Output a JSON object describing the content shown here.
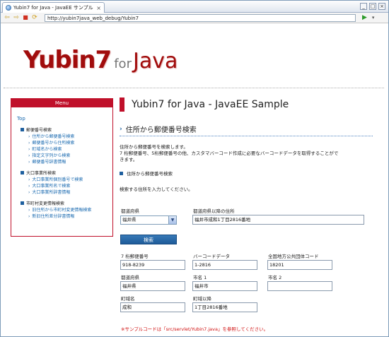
{
  "browser": {
    "tab_title": "Yubin7 for Java - JavaEE サンプル",
    "tab_close": "×",
    "url": "http://yubin7java_web_debug/Yubin7",
    "min": "_",
    "max": "□",
    "close": "×",
    "back": "⇦",
    "forward": "⇨",
    "stop": "■",
    "refresh": "⟳",
    "go": "▶",
    "menu": "▾"
  },
  "logo": {
    "main": "Yubin7",
    "for": "for",
    "java": "Java"
  },
  "sidebar": {
    "title": "Menu",
    "top": "Top",
    "sections": [
      {
        "label": "郵便番号検索",
        "items": [
          "住所から郵便番号検索",
          "郵便番号から住所検索",
          "町域名から検索",
          "指定文字列から検索",
          "郵便番号辞書情報"
        ]
      },
      {
        "label": "大口事業所検索",
        "items": [
          "大口事業所個別番号で検索",
          "大口事業所名で検索",
          "大口事業所辞書情報"
        ]
      },
      {
        "label": "市町村変更情報検索",
        "items": [
          "旧住所から市町村変更情報検索",
          "新旧住所差分辞書情報"
        ]
      }
    ]
  },
  "main": {
    "page_title": "Yubin7 for Java - JavaEE Sample",
    "section_title": "住所から郵便番号検索",
    "desc_line1": "住所から郵便番号を検索します。",
    "desc_line2": "7 桁郵便番号、5桁郵便番号の他、カスタマバーコード作成に必要なバーコードデータを取得することがで",
    "desc_line3": "きます。",
    "sub_title": "住所から郵便番号検索",
    "instruction": "検索する住所を入力してください。",
    "pref_label": "都道府県",
    "pref_value": "福井県",
    "addr_label": "都道府県以降の住所",
    "addr_value": "福井市成和1丁目2816番地",
    "search_button": "検索",
    "result": {
      "zip7_label": "7 桁郵便番号",
      "zip7": "918-8239",
      "barcode_label": "バーコードデータ",
      "barcode": "1-2816",
      "code_label": "全国地方公共団体コード",
      "code": "18201",
      "pref_label": "都道府県",
      "pref": "福井県",
      "city1_label": "市名 1",
      "city1": "福井市",
      "city2_label": "市名 2",
      "city2": "",
      "town_label": "町域名",
      "town": "成和",
      "after_label": "町域以降",
      "after": "1丁目2816番地"
    },
    "note": "※サンプルコードは「src/servlet/Yubin7.java」を参照してください。"
  },
  "colors": {
    "brand_red": "#c0102a",
    "link_blue": "#1a6ab0",
    "button_blue": "#1e5b99"
  }
}
